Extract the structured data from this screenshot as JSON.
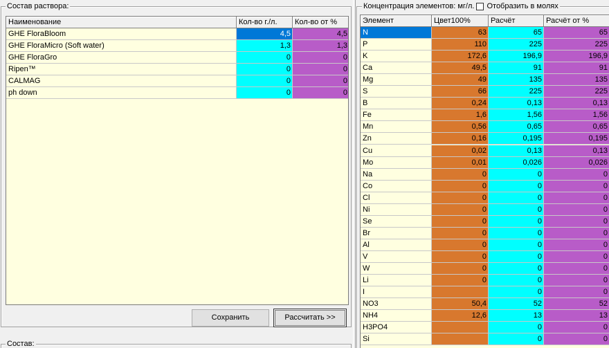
{
  "composition": {
    "title": "Состав раствора:",
    "headers": [
      "Наименование",
      "Кол-во г./л.",
      "Кол-во от %"
    ],
    "rows": [
      {
        "name": "GHE FloraBloom",
        "grams": "4,5",
        "percent": "4,5",
        "selected": true
      },
      {
        "name": "GHE FloraMicro (Soft water)",
        "grams": "1,3",
        "percent": "1,3"
      },
      {
        "name": "GHE FloraGro",
        "grams": "0",
        "percent": "0"
      },
      {
        "name": "Ripen™",
        "grams": "0",
        "percent": "0"
      },
      {
        "name": "CALMAG",
        "grams": "0",
        "percent": "0"
      },
      {
        "name": "ph down",
        "grams": "0",
        "percent": "0"
      }
    ],
    "save_label": "Сохранить",
    "calc_label": "Рассчитать >>"
  },
  "bottom_panel": {
    "title": "Состав:"
  },
  "concentration": {
    "title": "Концентрация элементов: мг/л.",
    "moles_label": "Отобразить в молях",
    "moles_checked": false,
    "headers": [
      "Элемент",
      "Цвет100%",
      "Расчёт",
      "Расчёт от %"
    ],
    "rows": [
      {
        "el": "N",
        "target": "63",
        "calc": "65",
        "pct": "65",
        "selected": true
      },
      {
        "el": "P",
        "target": "110",
        "calc": "225",
        "pct": "225"
      },
      {
        "el": "K",
        "target": "172,6",
        "calc": "196,9",
        "pct": "196,9"
      },
      {
        "el": "Ca",
        "target": "49,5",
        "calc": "91",
        "pct": "91"
      },
      {
        "el": "Mg",
        "target": "49",
        "calc": "135",
        "pct": "135"
      },
      {
        "el": "S",
        "target": "66",
        "calc": "225",
        "pct": "225"
      },
      {
        "el": "B",
        "target": "0,24",
        "calc": "0,13",
        "pct": "0,13"
      },
      {
        "el": "Fe",
        "target": "1,6",
        "calc": "1,56",
        "pct": "1,56"
      },
      {
        "el": "Mn",
        "target": "0,56",
        "calc": "0,65",
        "pct": "0,65"
      },
      {
        "el": "Zn",
        "target": "0,16",
        "calc": "0,195",
        "pct": "0,195"
      },
      {
        "el": "Cu",
        "target": "0,02",
        "calc": "0,13",
        "pct": "0,13"
      },
      {
        "el": "Mo",
        "target": "0,01",
        "calc": "0,026",
        "pct": "0,026"
      },
      {
        "el": "Na",
        "target": "0",
        "calc": "0",
        "pct": "0"
      },
      {
        "el": "Co",
        "target": "0",
        "calc": "0",
        "pct": "0"
      },
      {
        "el": "Cl",
        "target": "0",
        "calc": "0",
        "pct": "0"
      },
      {
        "el": "Ni",
        "target": "0",
        "calc": "0",
        "pct": "0"
      },
      {
        "el": "Se",
        "target": "0",
        "calc": "0",
        "pct": "0"
      },
      {
        "el": "Br",
        "target": "0",
        "calc": "0",
        "pct": "0"
      },
      {
        "el": "Al",
        "target": "0",
        "calc": "0",
        "pct": "0"
      },
      {
        "el": "V",
        "target": "0",
        "calc": "0",
        "pct": "0"
      },
      {
        "el": "W",
        "target": "0",
        "calc": "0",
        "pct": "0"
      },
      {
        "el": "Li",
        "target": "0",
        "calc": "0",
        "pct": "0"
      },
      {
        "el": "I",
        "target": "",
        "calc": "0",
        "pct": "0"
      },
      {
        "el": "NO3",
        "target": "50,4",
        "calc": "52",
        "pct": "52"
      },
      {
        "el": "NH4",
        "target": "12,6",
        "calc": "13",
        "pct": "13"
      },
      {
        "el": "H3PO4",
        "target": "",
        "calc": "0",
        "pct": "0"
      },
      {
        "el": "Si",
        "target": "",
        "calc": "0",
        "pct": "0"
      }
    ]
  },
  "colors": {
    "grid_bg": "#ffffe0",
    "cyan": "#00ffff",
    "purple": "#b85cc8",
    "orange": "#d8782e",
    "selection": "#0078d7"
  }
}
